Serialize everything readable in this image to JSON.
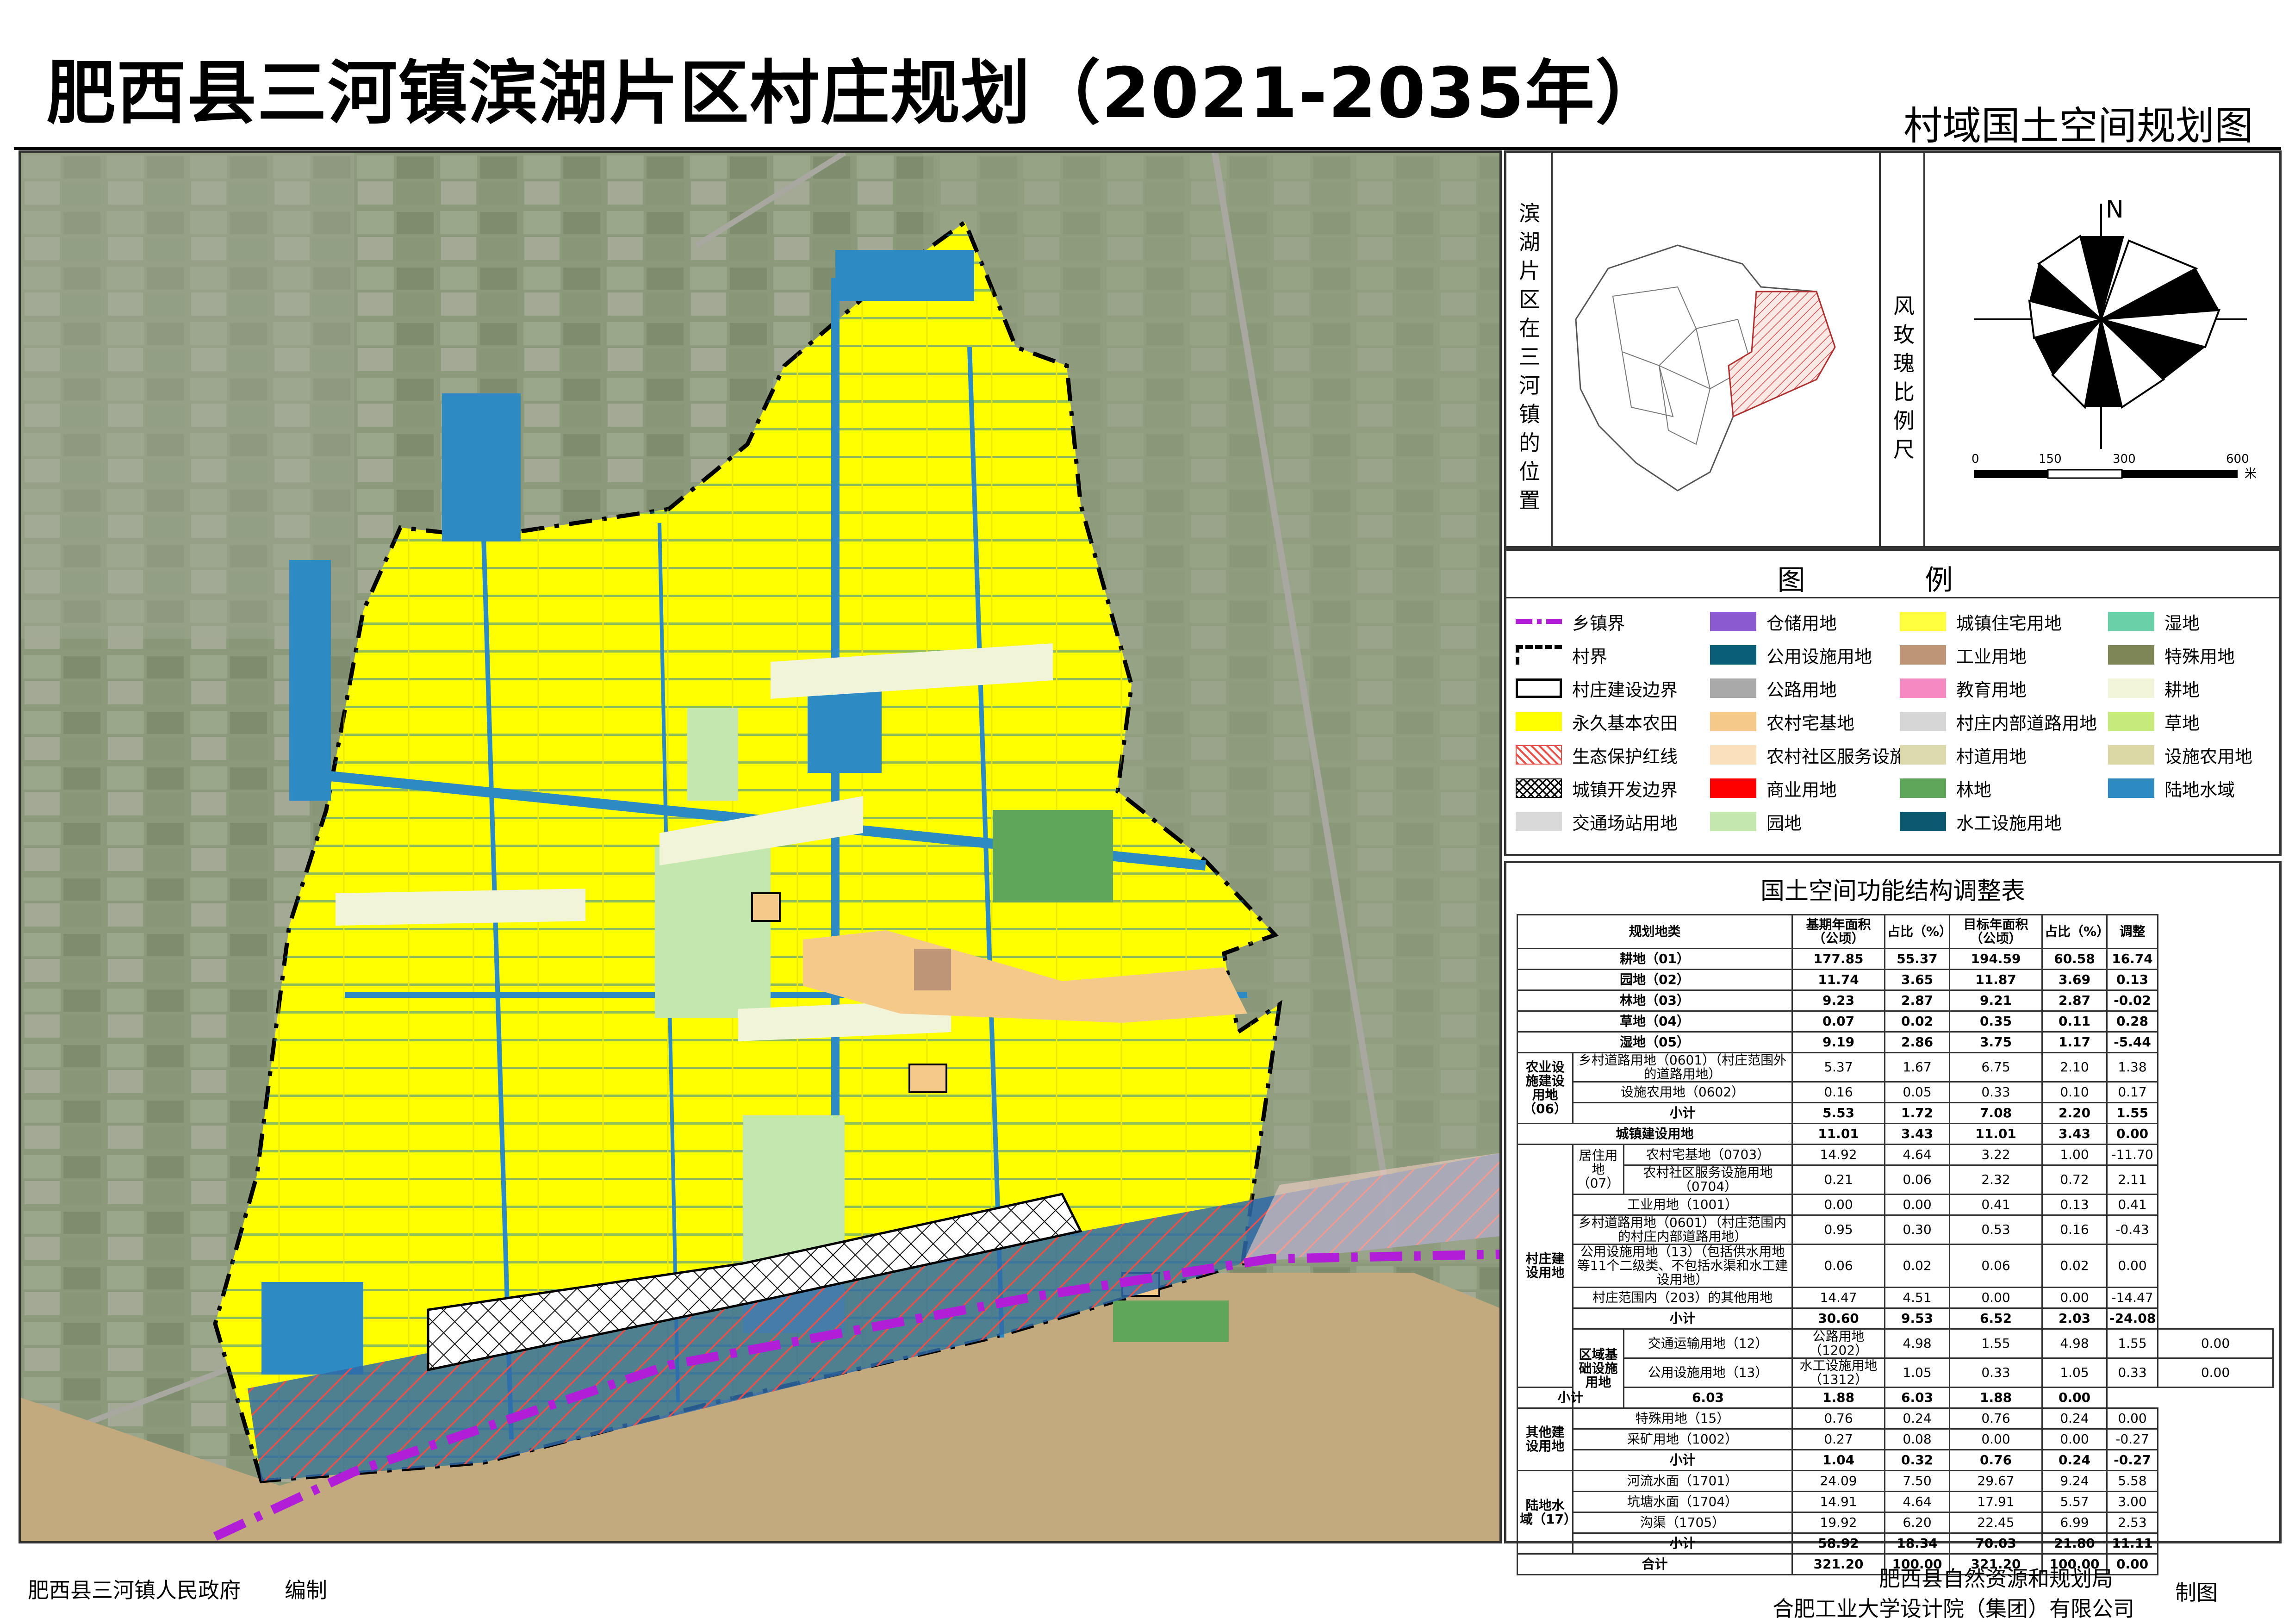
{
  "header": {
    "title": "肥西县三河镇滨湖片区村庄规划（2021-2035年）",
    "subtitle": "村域国土空间规划图"
  },
  "location_panel": {
    "vertical_label_chars": [
      "滨",
      "湖",
      "片",
      "区",
      "在",
      "三",
      "河",
      "镇",
      "的",
      "位",
      "置"
    ],
    "scale_label_chars": [
      "风",
      "玫",
      "瑰",
      "比",
      "例",
      "尺"
    ],
    "north_label": "N",
    "scale_ticks": [
      "0",
      "150",
      "300",
      "600"
    ],
    "scale_unit": "米"
  },
  "legend": {
    "title": "图    例",
    "items": [
      {
        "label": "乡镇界",
        "kind": "dashdot",
        "color": "#b01ed8"
      },
      {
        "label": "村界",
        "kind": "dashed",
        "color": "#000000"
      },
      {
        "label": "村庄建设边界",
        "kind": "outline",
        "color": "#000000"
      },
      {
        "label": "永久基本农田",
        "kind": "fill",
        "color": "#ffff00"
      },
      {
        "label": "生态保护红线",
        "kind": "hatch",
        "color": "#e8504a"
      },
      {
        "label": "城镇开发边界",
        "kind": "cross",
        "color": "#000000"
      },
      {
        "label": "交通场站用地",
        "kind": "fill",
        "color": "#d9d9d9"
      },
      {
        "label": "仓储用地",
        "kind": "fill",
        "color": "#8c5ad0"
      },
      {
        "label": "公用设施用地",
        "kind": "fill",
        "color": "#0b5e78"
      },
      {
        "label": "公路用地",
        "kind": "fill",
        "color": "#a8a8a8"
      },
      {
        "label": "农村宅基地",
        "kind": "fill",
        "color": "#f5c98a"
      },
      {
        "label": "农村社区服务设施用地",
        "kind": "fill",
        "color": "#fbe0bd"
      },
      {
        "label": "商业用地",
        "kind": "fill",
        "color": "#ff0000"
      },
      {
        "label": "园地",
        "kind": "fill",
        "color": "#c4e7b0"
      },
      {
        "label": "城镇住宅用地",
        "kind": "fill",
        "color": "#ffff40"
      },
      {
        "label": "工业用地",
        "kind": "fill",
        "color": "#bf9578"
      },
      {
        "label": "教育用地",
        "kind": "fill",
        "color": "#f58ac3"
      },
      {
        "label": "村庄内部道路用地",
        "kind": "fill",
        "color": "#d6d6d6"
      },
      {
        "label": "村道用地",
        "kind": "fill",
        "color": "#dcd9ad"
      },
      {
        "label": "林地",
        "kind": "fill",
        "color": "#5fa55a"
      },
      {
        "label": "水工设施用地",
        "kind": "fill",
        "color": "#0c5870"
      },
      {
        "label": "湿地",
        "kind": "fill",
        "color": "#6ad0a8"
      },
      {
        "label": "特殊用地",
        "kind": "fill",
        "color": "#7f8655"
      },
      {
        "label": "耕地",
        "kind": "fill",
        "color": "#f1f4d8"
      },
      {
        "label": "草地",
        "kind": "fill",
        "color": "#c6ea7c"
      },
      {
        "label": "设施农用地",
        "kind": "fill",
        "color": "#dcd8a6"
      },
      {
        "label": "陆地水域",
        "kind": "fill",
        "color": "#2d8ac3"
      }
    ]
  },
  "table": {
    "title": "国土空间功能结构调整表",
    "headers": [
      "规划地类",
      "基期年面积（公顷）",
      "占比（%）",
      "目标年面积（公顷）",
      "占比（%）",
      "调整"
    ],
    "rows": [
      {
        "type": "main",
        "label": "耕地（01）",
        "v": [
          "177.85",
          "55.37",
          "194.59",
          "60.58",
          "16.74"
        ]
      },
      {
        "type": "main",
        "label": "园地（02）",
        "v": [
          "11.74",
          "3.65",
          "11.87",
          "3.69",
          "0.13"
        ]
      },
      {
        "type": "main",
        "label": "林地（03）",
        "v": [
          "9.23",
          "2.87",
          "9.21",
          "2.87",
          "-0.02"
        ]
      },
      {
        "type": "main",
        "label": "草地（04）",
        "v": [
          "0.07",
          "0.02",
          "0.35",
          "0.11",
          "0.28"
        ]
      },
      {
        "type": "main",
        "label": "湿地（05）",
        "v": [
          "9.19",
          "2.86",
          "3.75",
          "1.17",
          "-5.44"
        ]
      },
      {
        "type": "g2",
        "group": "农业设施建设用地（06）",
        "span": 3,
        "label": "乡村道路用地（0601）（村庄范围外的道路用地）",
        "v": [
          "5.37",
          "1.67",
          "6.75",
          "2.10",
          "1.38"
        ]
      },
      {
        "type": "g2c",
        "label": "设施农用地（0602）",
        "v": [
          "0.16",
          "0.05",
          "0.33",
          "0.10",
          "0.17"
        ]
      },
      {
        "type": "g2c",
        "label": "小计",
        "bold": true,
        "v": [
          "5.53",
          "1.72",
          "7.08",
          "2.20",
          "1.55"
        ]
      },
      {
        "type": "main",
        "label": "城镇建设用地",
        "v": [
          "11.01",
          "3.43",
          "11.01",
          "3.43",
          "0.00"
        ]
      },
      {
        "type": "g3",
        "group": "村庄建设用地",
        "span": 9,
        "sub": "居住用地（07）",
        "subspan": 2,
        "label": "农村宅基地（0703）",
        "v": [
          "14.92",
          "4.64",
          "3.22",
          "1.00",
          "-11.70"
        ]
      },
      {
        "type": "g3c",
        "label": "农村社区服务设施用地（0704）",
        "v": [
          "0.21",
          "0.06",
          "2.32",
          "0.72",
          "2.11"
        ]
      },
      {
        "type": "g2c",
        "label": "工业用地（1001）",
        "v": [
          "0.00",
          "0.00",
          "0.41",
          "0.13",
          "0.41"
        ]
      },
      {
        "type": "g2c",
        "label": "乡村道路用地（0601）（村庄范围内的村庄内部道路用地）",
        "v": [
          "0.95",
          "0.30",
          "0.53",
          "0.16",
          "-0.43"
        ]
      },
      {
        "type": "g2c",
        "label": "公用设施用地（13）（包括供水用地等11个二级类、不包括水渠和水工建设用地）",
        "v": [
          "0.06",
          "0.02",
          "0.06",
          "0.02",
          "0.00"
        ]
      },
      {
        "type": "g2c",
        "label": "村庄范围内（203）的其他用地",
        "v": [
          "14.47",
          "4.51",
          "0.00",
          "0.00",
          "-14.47"
        ]
      },
      {
        "type": "g2c",
        "label": "小计",
        "bold": true,
        "v": [
          "30.60",
          "9.53",
          "6.52",
          "2.03",
          "-24.08"
        ]
      },
      {
        "type": "g3",
        "group": "区域基础设施用地",
        "span": 3,
        "sub": "交通运输用地（12）",
        "subspan": 1,
        "label": "公路用地（1202）",
        "v": [
          "4.98",
          "1.55",
          "4.98",
          "1.55",
          "0.00"
        ]
      },
      {
        "type": "g3d",
        "sub": "公用设施用地（13）",
        "label": "水工设施用地（1312）",
        "v": [
          "1.05",
          "0.33",
          "1.05",
          "0.33",
          "0.00"
        ]
      },
      {
        "type": "g2c",
        "label": "小计",
        "bold": true,
        "v": [
          "6.03",
          "1.88",
          "6.03",
          "1.88",
          "0.00"
        ]
      },
      {
        "type": "g2",
        "group": "其他建设用地",
        "span": 3,
        "label": "特殊用地（15）",
        "v": [
          "0.76",
          "0.24",
          "0.76",
          "0.24",
          "0.00"
        ]
      },
      {
        "type": "g2c",
        "label": "采矿用地（1002）",
        "v": [
          "0.27",
          "0.08",
          "0.00",
          "0.00",
          "-0.27"
        ]
      },
      {
        "type": "g2c",
        "label": "小计",
        "bold": true,
        "v": [
          "1.04",
          "0.32",
          "0.76",
          "0.24",
          "-0.27"
        ]
      },
      {
        "type": "g2",
        "group": "陆地水域（17）",
        "span": 4,
        "label": "河流水面（1701）",
        "v": [
          "24.09",
          "7.50",
          "29.67",
          "9.24",
          "5.58"
        ]
      },
      {
        "type": "g2c",
        "label": "坑塘水面（1704）",
        "v": [
          "14.91",
          "4.64",
          "17.91",
          "5.57",
          "3.00"
        ]
      },
      {
        "type": "g2c",
        "label": "沟渠（1705）",
        "v": [
          "19.92",
          "6.20",
          "22.45",
          "6.99",
          "2.53"
        ]
      },
      {
        "type": "g2c",
        "label": "小计",
        "bold": true,
        "v": [
          "58.92",
          "18.34",
          "70.03",
          "21.80",
          "11.11"
        ]
      },
      {
        "type": "main",
        "label": "合计",
        "v": [
          "321.20",
          "100.00",
          "321.20",
          "100.00",
          "0.00"
        ]
      }
    ]
  },
  "footer": {
    "left_org": "肥西县三河镇人民政府",
    "left_role": "编制",
    "right_org1": "肥西县自然资源和规划局",
    "right_org2": "合肥工业大学设计院（集团）有限公司",
    "right_role": "制图"
  },
  "colors": {
    "basic_farmland": "#ffff00",
    "water": "#2d8ac3",
    "river": "#c2a97e",
    "forest": "#5fa55a",
    "orchard": "#c4e7b0",
    "homestead": "#f5c98a",
    "township_boundary": "#b01ed8",
    "eco_redline": "#e8504a"
  }
}
